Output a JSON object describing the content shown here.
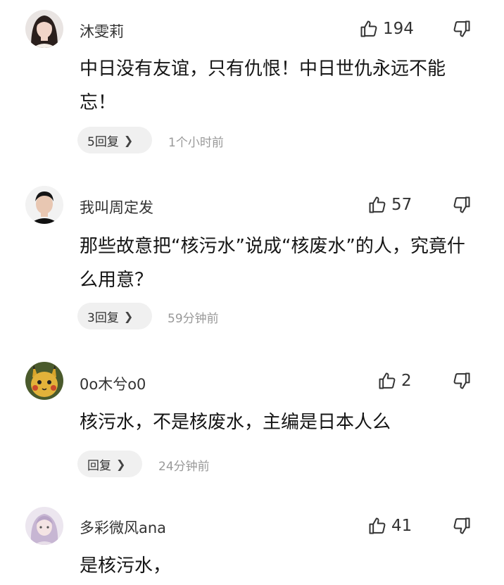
{
  "comments": [
    {
      "username": "沐雯莉",
      "avatar_icon": "avatar-woman",
      "likes": "194",
      "text": "中日没有友谊，只有仇恨！中日世仇永远不能忘！",
      "reply_label": "5回复",
      "time": "1个小时前"
    },
    {
      "username": "我叫周定发",
      "avatar_icon": "avatar-man",
      "likes": "57",
      "text": "那些故意把“核污水”说成“核废水”的人，究竟什么用意？",
      "reply_label": "3回复",
      "time": "59分钟前"
    },
    {
      "username": "0o木兮o0",
      "avatar_icon": "avatar-pikachu",
      "likes": "2",
      "text": "核污水，不是核废水，主编是日本人么",
      "reply_label": "回复",
      "time": "24分钟前"
    },
    {
      "username": "多彩微风ana",
      "avatar_icon": "avatar-girl",
      "likes": "41",
      "text": "是核污水，"
    }
  ],
  "icons": {
    "like": "thumb-up-icon",
    "dislike": "thumb-down-icon",
    "chevron": "chevron-right-icon"
  },
  "colors": {
    "background": "#ffffff",
    "pill_bg": "#f0f0f0",
    "meta_text": "#999999"
  }
}
